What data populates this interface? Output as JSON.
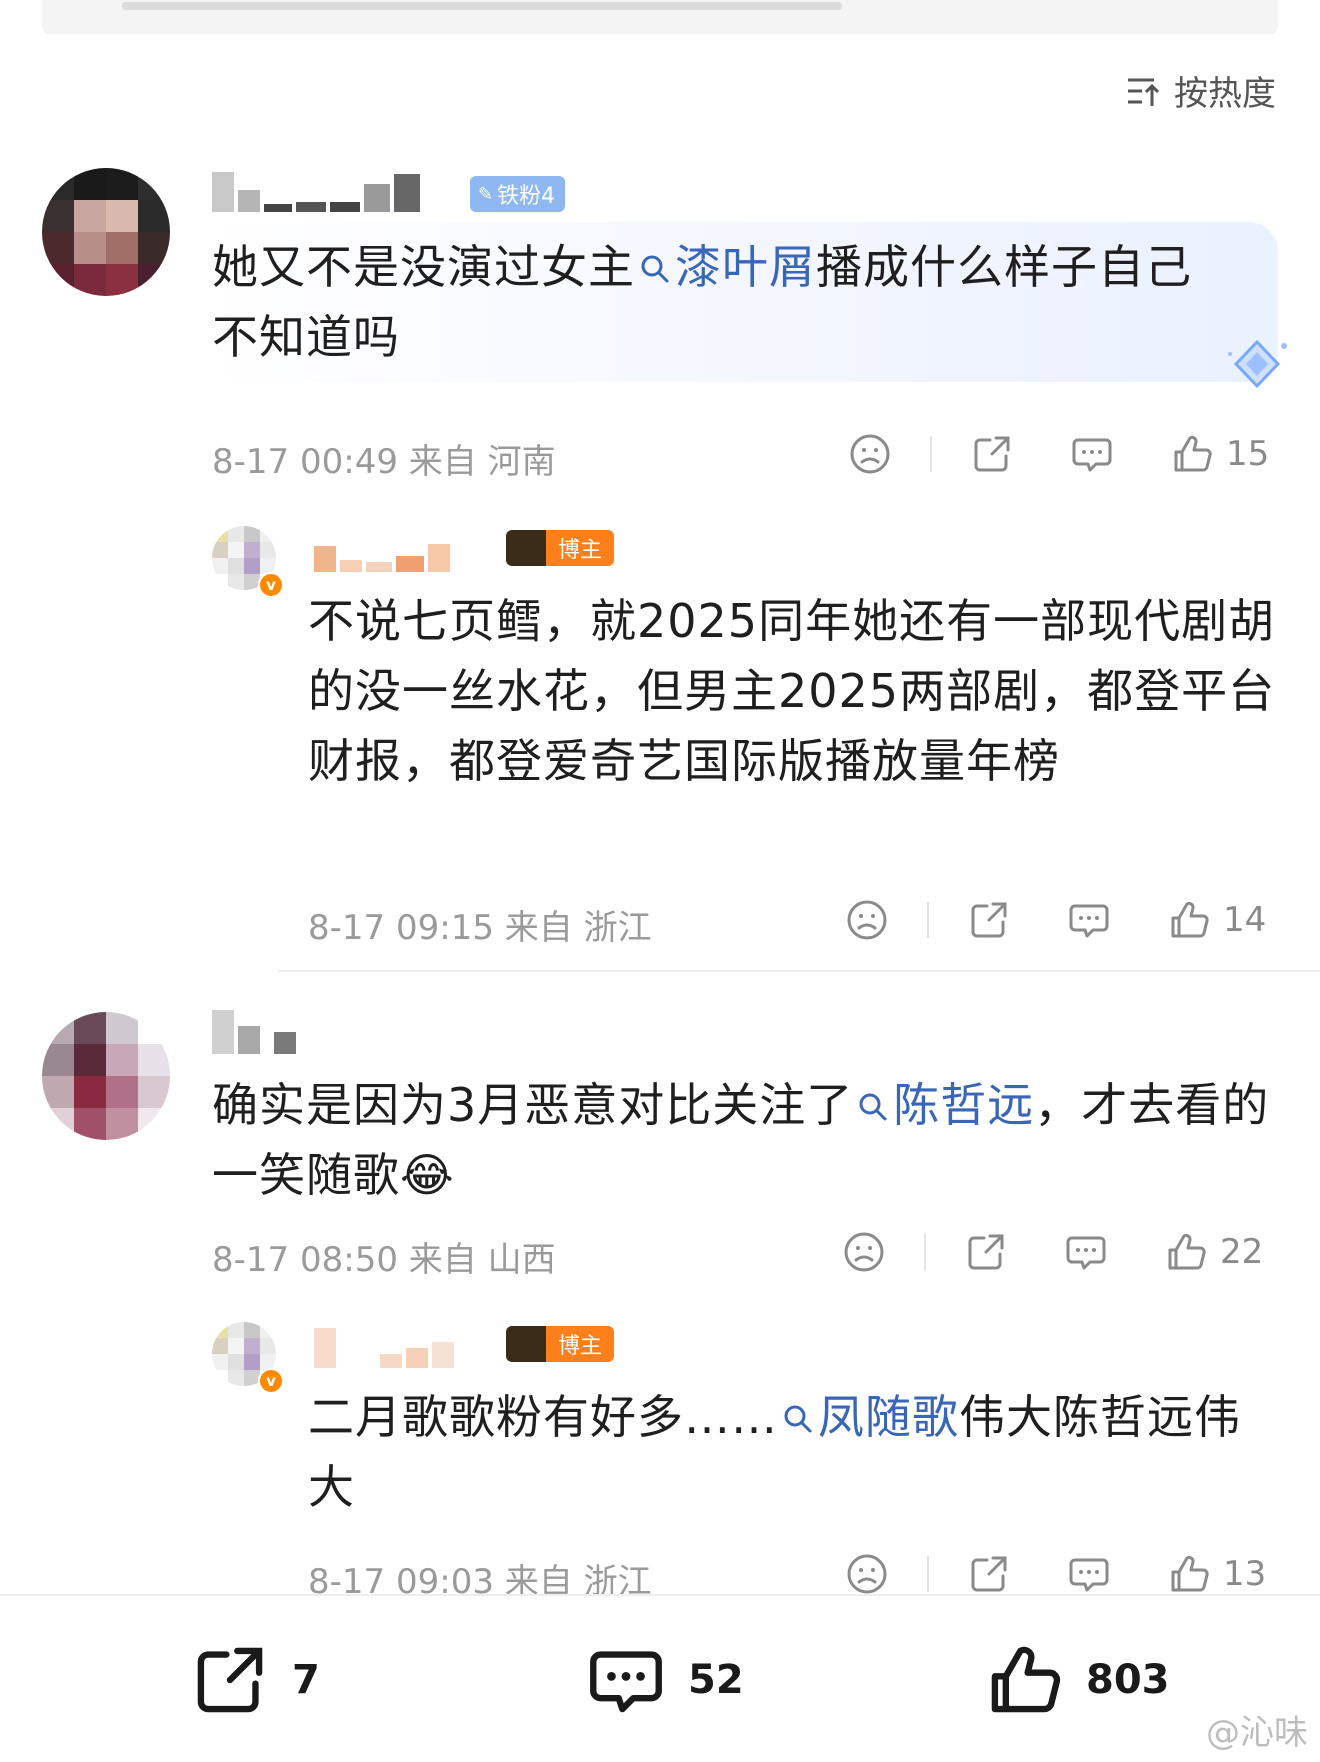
{
  "sort": {
    "label": "按热度"
  },
  "comments": [
    {
      "badge": "铁粉4",
      "text_before": "她又不是没演过女主",
      "link": "漆叶屑",
      "text_after": "播成什么样子自己不知道吗",
      "time": "8-17 00:49",
      "from": "来自",
      "location": "河南",
      "likes": "15"
    },
    {
      "reply": true,
      "badge": "博主",
      "text": "不说七页鳕，就2025同年她还有一部现代剧胡的没一丝水花，但男主2025两部剧，都登平台财报，都登爱奇艺国际版播放量年榜",
      "time": "8-17 09:15",
      "from": "来自",
      "location": "浙江",
      "likes": "14"
    },
    {
      "text_before": "确实是因为3月恶意对比关注了",
      "link": "陈哲远",
      "text_after": "，才去看的一笑随歌",
      "emoji": "😂",
      "time": "8-17 08:50",
      "from": "来自",
      "location": "山西",
      "likes": "22"
    },
    {
      "reply": true,
      "badge": "博主",
      "text_before": "二月歌歌粉有好多……",
      "link": "凤随歌",
      "text_after": "伟大陈哲远伟大",
      "time": "8-17 09:03",
      "from": "来自",
      "location": "浙江",
      "likes": "13"
    }
  ],
  "bottom_bar": {
    "reposts": "7",
    "comments": "52",
    "likes": "803"
  },
  "watermark": "@沁味",
  "icons": {
    "sort": "sort-icon",
    "search": "search-icon",
    "dislike": "dislike-face-icon",
    "share": "share-icon",
    "comment": "comment-icon",
    "like": "thumbs-up-icon",
    "diamond": "diamond-sticker-icon"
  },
  "colors": {
    "link": "#3a66b8",
    "host_badge": "#ff7f1a",
    "fan_badge": "#8fb8f2",
    "meta": "#9a9a9a"
  }
}
